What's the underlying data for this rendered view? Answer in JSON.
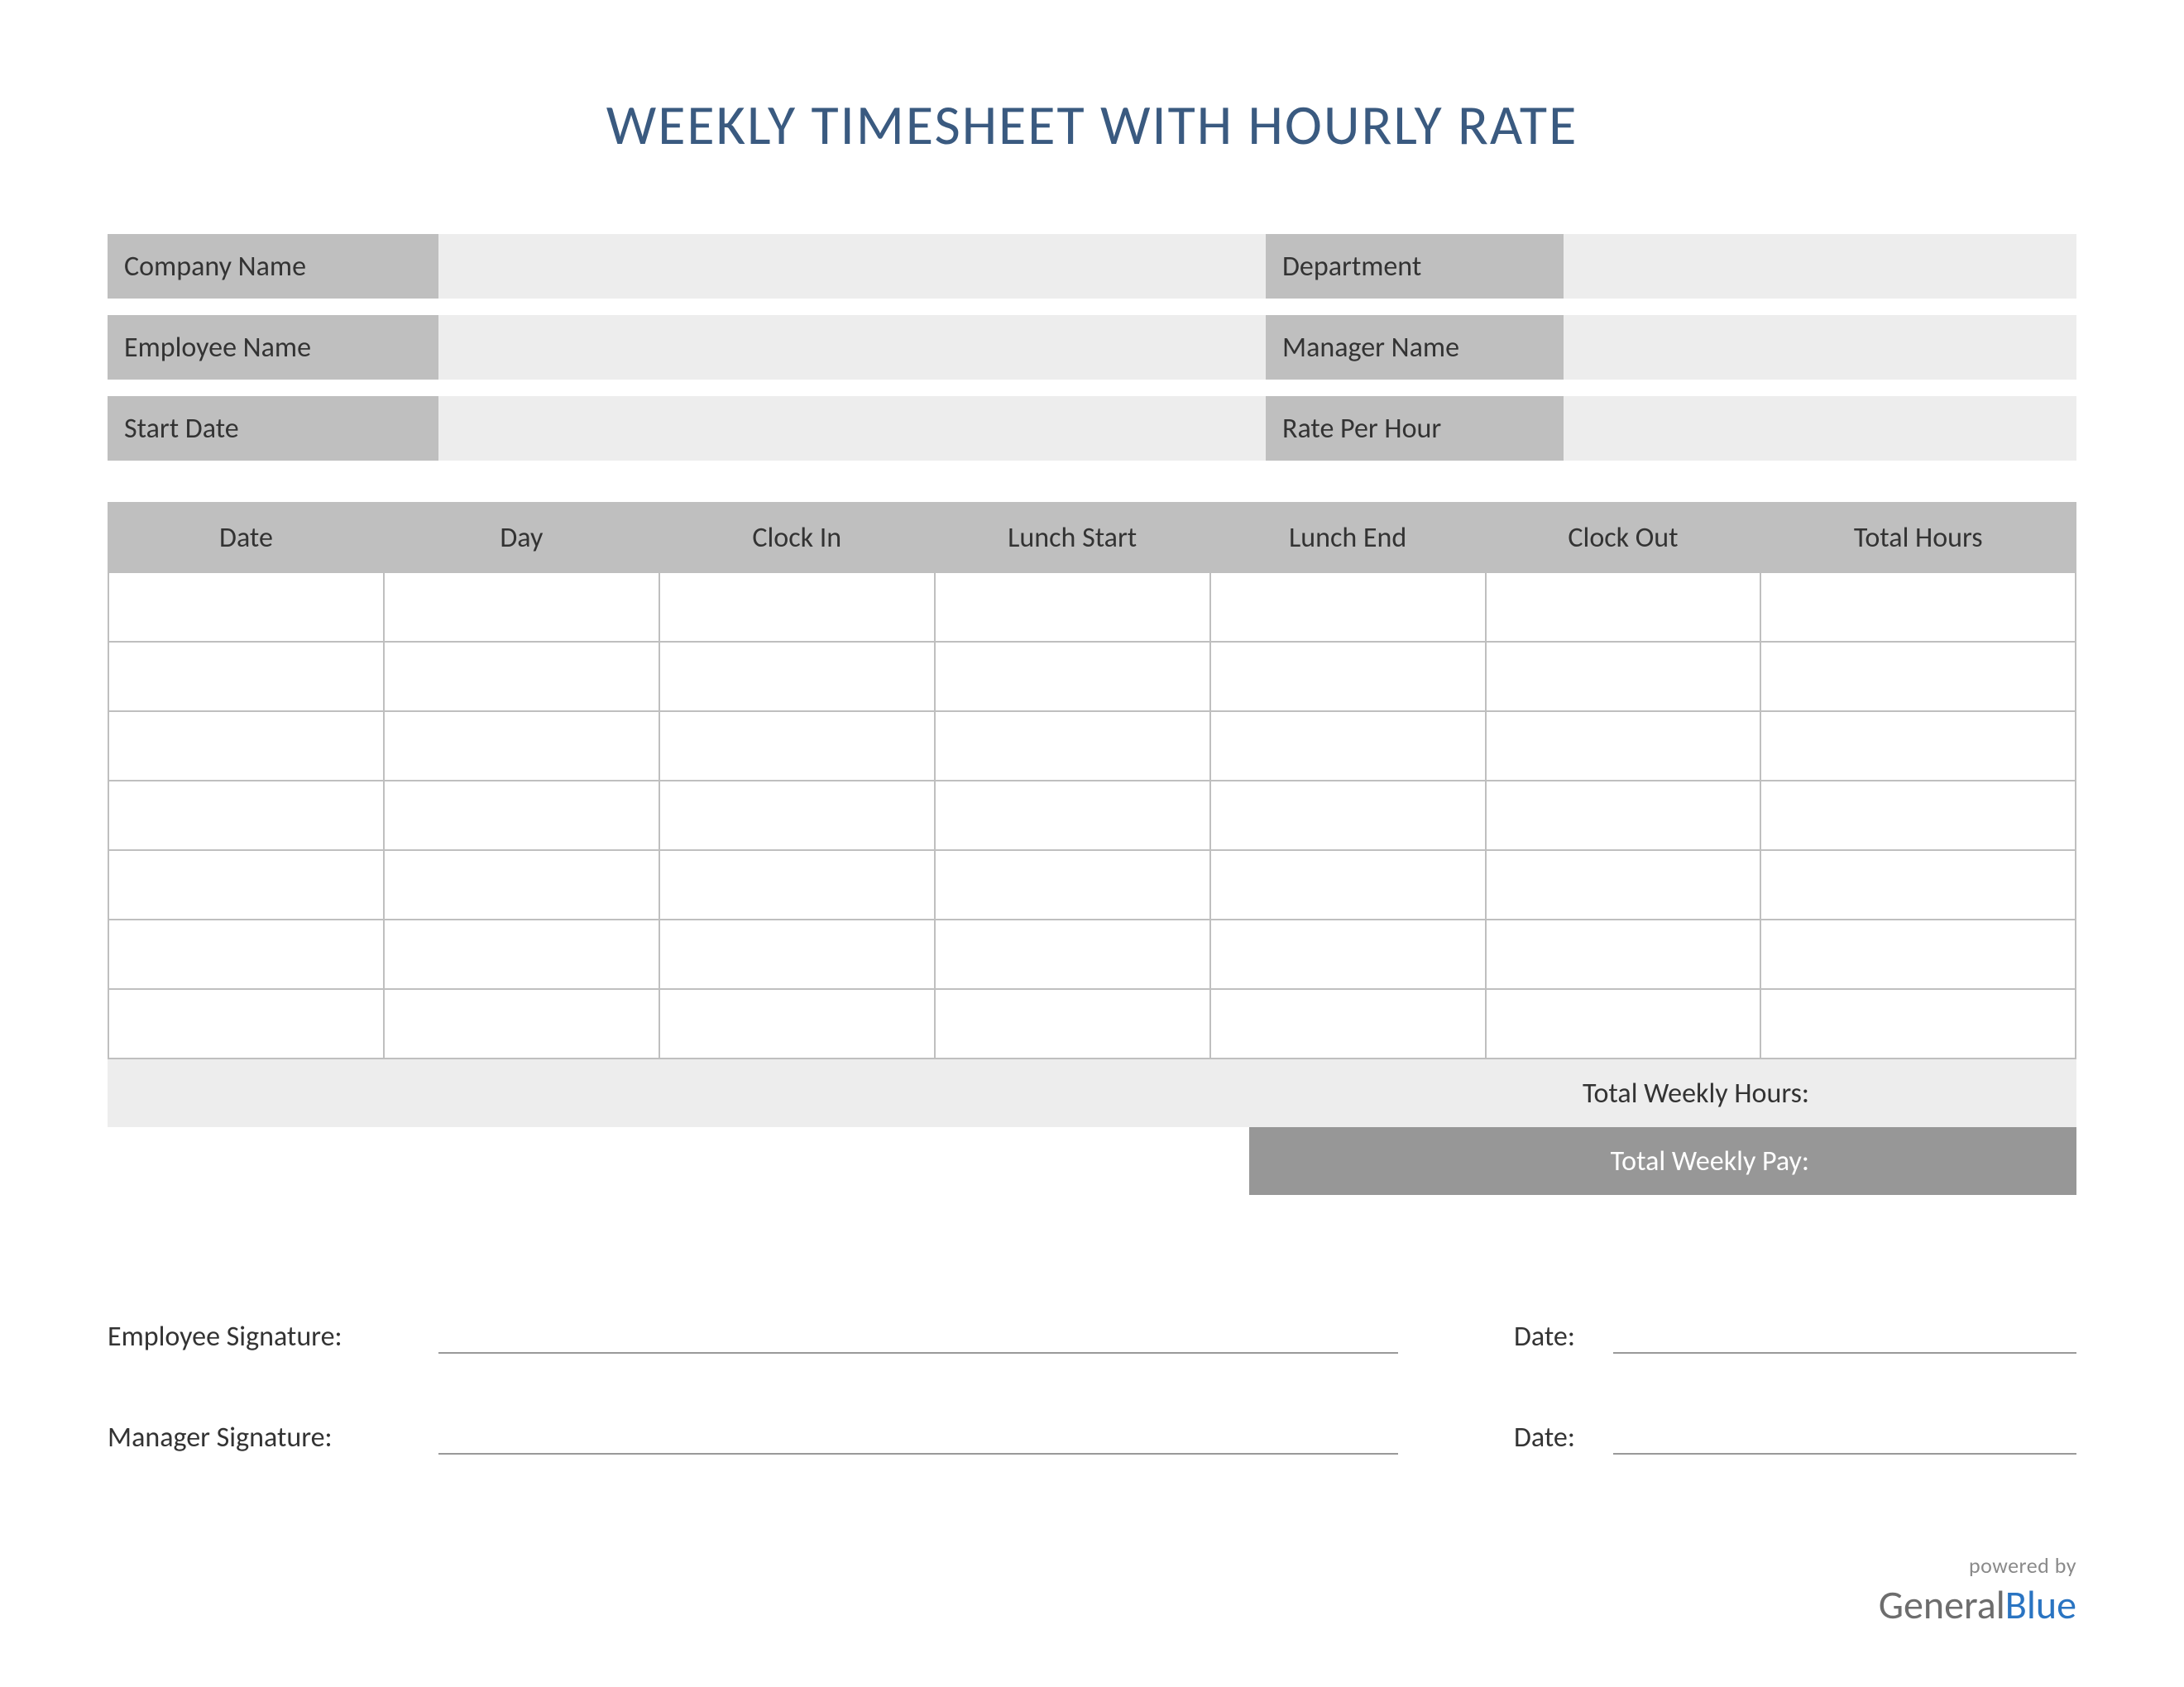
{
  "title": "WEEKLY TIMESHEET WITH HOURLY RATE",
  "header": {
    "company_label": "Company Name",
    "company_value": "",
    "department_label": "Department",
    "department_value": "",
    "employee_label": "Employee Name",
    "employee_value": "",
    "manager_label": "Manager Name",
    "manager_value": "",
    "start_date_label": "Start Date",
    "start_date_value": "",
    "rate_label": "Rate Per Hour",
    "rate_value": ""
  },
  "columns": {
    "date": "Date",
    "day": "Day",
    "clock_in": "Clock In",
    "lunch_start": "Lunch Start",
    "lunch_end": "Lunch End",
    "clock_out": "Clock Out",
    "total_hours": "Total Hours"
  },
  "rows": [
    {
      "date": "",
      "day": "",
      "clock_in": "",
      "lunch_start": "",
      "lunch_end": "",
      "clock_out": "",
      "total_hours": ""
    },
    {
      "date": "",
      "day": "",
      "clock_in": "",
      "lunch_start": "",
      "lunch_end": "",
      "clock_out": "",
      "total_hours": ""
    },
    {
      "date": "",
      "day": "",
      "clock_in": "",
      "lunch_start": "",
      "lunch_end": "",
      "clock_out": "",
      "total_hours": ""
    },
    {
      "date": "",
      "day": "",
      "clock_in": "",
      "lunch_start": "",
      "lunch_end": "",
      "clock_out": "",
      "total_hours": ""
    },
    {
      "date": "",
      "day": "",
      "clock_in": "",
      "lunch_start": "",
      "lunch_end": "",
      "clock_out": "",
      "total_hours": ""
    },
    {
      "date": "",
      "day": "",
      "clock_in": "",
      "lunch_start": "",
      "lunch_end": "",
      "clock_out": "",
      "total_hours": ""
    },
    {
      "date": "",
      "day": "",
      "clock_in": "",
      "lunch_start": "",
      "lunch_end": "",
      "clock_out": "",
      "total_hours": ""
    }
  ],
  "totals": {
    "weekly_hours_label": "Total Weekly Hours:",
    "weekly_hours_value": "",
    "weekly_pay_label": "Total Weekly Pay:",
    "weekly_pay_value": ""
  },
  "signatures": {
    "employee_label": "Employee Signature:",
    "employee_date_label": "Date:",
    "manager_label": "Manager Signature:",
    "manager_date_label": "Date:"
  },
  "footer": {
    "powered": "powered by",
    "logo_general": "General",
    "logo_blue": "Blue"
  }
}
